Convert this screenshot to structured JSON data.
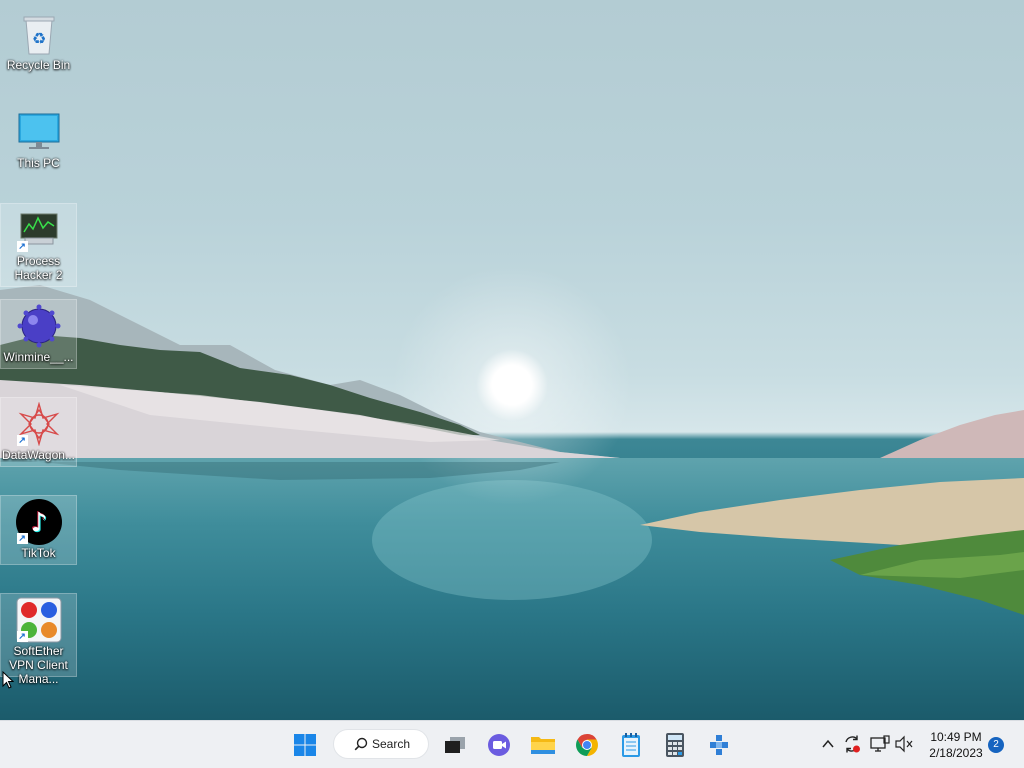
{
  "desktop_icons": [
    {
      "label": "Recycle Bin",
      "icon": "recycle-bin-icon"
    },
    {
      "label": "This PC",
      "icon": "monitor-icon"
    },
    {
      "label": "Process Hacker 2",
      "icon": "process-hacker-icon"
    },
    {
      "label": "Winmine__...",
      "icon": "mine-icon"
    },
    {
      "label": "DataWagon...",
      "icon": "datawagon-icon"
    },
    {
      "label": "TikTok",
      "icon": "tiktok-icon"
    },
    {
      "label": "SoftEther VPN Client Mana...",
      "icon": "softether-icon"
    }
  ],
  "taskbar": {
    "search_label": "Search",
    "apps": [
      "start-icon",
      "task-view-icon",
      "chat-icon",
      "file-explorer-icon",
      "chrome-icon",
      "notepad-icon",
      "calculator-icon",
      "app-icon"
    ]
  },
  "tray": {
    "time": "10:49 PM",
    "date": "2/18/2023",
    "notification_count": "2"
  },
  "colors": {
    "taskbar_bg": "#eef0f3",
    "accent": "#1664c0"
  }
}
